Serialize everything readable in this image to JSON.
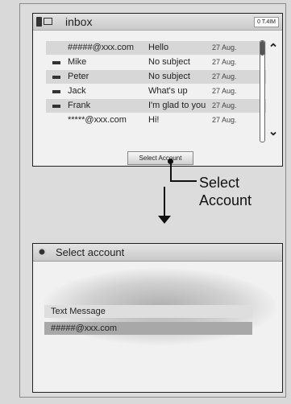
{
  "inbox": {
    "title": "inbox",
    "status_badge": "0 T.4IM",
    "messages": [
      {
        "sender": "#####@xxx.com",
        "subject": "Hello",
        "date": "27 Aug.",
        "icon": "none"
      },
      {
        "sender": "Mike",
        "subject": "No subject",
        "date": "27 Aug.",
        "icon": "mail-icon"
      },
      {
        "sender": "Peter",
        "subject": "No subject",
        "date": "27 Aug.",
        "icon": "mail-icon"
      },
      {
        "sender": "Jack",
        "subject": "What's up",
        "date": "27 Aug.",
        "icon": "mail-icon"
      },
      {
        "sender": "Frank",
        "subject": "I'm glad to you",
        "date": "27 Aug.",
        "icon": "mail-icon"
      },
      {
        "sender": "*****@xxx.com",
        "subject": "Hi!",
        "date": "27 Aug.",
        "icon": "none"
      }
    ],
    "scroll_up_glyph": "⌃",
    "scroll_down_glyph": "⌄",
    "select_account_button": "Select Account"
  },
  "callout": {
    "line1": "Select",
    "line2": "Account"
  },
  "account_screen": {
    "title": "Select account",
    "options": [
      {
        "label": "Text Message",
        "selected": false
      },
      {
        "label": "#####@xxx.com",
        "selected": true
      }
    ]
  }
}
